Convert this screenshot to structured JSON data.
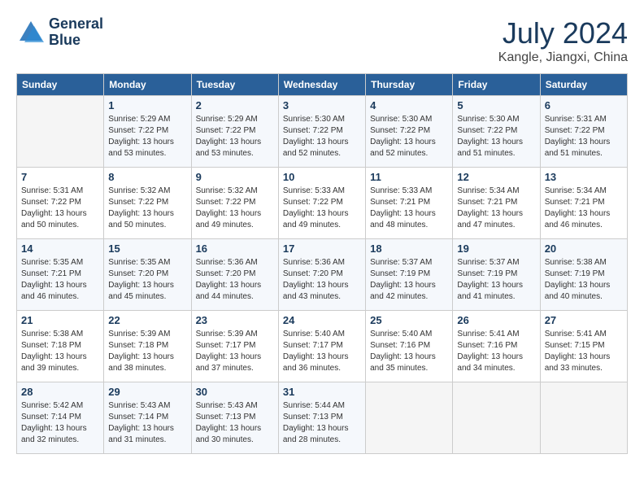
{
  "header": {
    "logo_line1": "General",
    "logo_line2": "Blue",
    "title": "July 2024",
    "location": "Kangle, Jiangxi, China"
  },
  "weekdays": [
    "Sunday",
    "Monday",
    "Tuesday",
    "Wednesday",
    "Thursday",
    "Friday",
    "Saturday"
  ],
  "weeks": [
    [
      {
        "day": "",
        "empty": true
      },
      {
        "day": "1",
        "sunrise": "5:29 AM",
        "sunset": "7:22 PM",
        "daylight": "13 hours and 53 minutes."
      },
      {
        "day": "2",
        "sunrise": "5:29 AM",
        "sunset": "7:22 PM",
        "daylight": "13 hours and 53 minutes."
      },
      {
        "day": "3",
        "sunrise": "5:30 AM",
        "sunset": "7:22 PM",
        "daylight": "13 hours and 52 minutes."
      },
      {
        "day": "4",
        "sunrise": "5:30 AM",
        "sunset": "7:22 PM",
        "daylight": "13 hours and 52 minutes."
      },
      {
        "day": "5",
        "sunrise": "5:30 AM",
        "sunset": "7:22 PM",
        "daylight": "13 hours and 51 minutes."
      },
      {
        "day": "6",
        "sunrise": "5:31 AM",
        "sunset": "7:22 PM",
        "daylight": "13 hours and 51 minutes."
      }
    ],
    [
      {
        "day": "7",
        "sunrise": "5:31 AM",
        "sunset": "7:22 PM",
        "daylight": "13 hours and 50 minutes."
      },
      {
        "day": "8",
        "sunrise": "5:32 AM",
        "sunset": "7:22 PM",
        "daylight": "13 hours and 50 minutes."
      },
      {
        "day": "9",
        "sunrise": "5:32 AM",
        "sunset": "7:22 PM",
        "daylight": "13 hours and 49 minutes."
      },
      {
        "day": "10",
        "sunrise": "5:33 AM",
        "sunset": "7:22 PM",
        "daylight": "13 hours and 49 minutes."
      },
      {
        "day": "11",
        "sunrise": "5:33 AM",
        "sunset": "7:21 PM",
        "daylight": "13 hours and 48 minutes."
      },
      {
        "day": "12",
        "sunrise": "5:34 AM",
        "sunset": "7:21 PM",
        "daylight": "13 hours and 47 minutes."
      },
      {
        "day": "13",
        "sunrise": "5:34 AM",
        "sunset": "7:21 PM",
        "daylight": "13 hours and 46 minutes."
      }
    ],
    [
      {
        "day": "14",
        "sunrise": "5:35 AM",
        "sunset": "7:21 PM",
        "daylight": "13 hours and 46 minutes."
      },
      {
        "day": "15",
        "sunrise": "5:35 AM",
        "sunset": "7:20 PM",
        "daylight": "13 hours and 45 minutes."
      },
      {
        "day": "16",
        "sunrise": "5:36 AM",
        "sunset": "7:20 PM",
        "daylight": "13 hours and 44 minutes."
      },
      {
        "day": "17",
        "sunrise": "5:36 AM",
        "sunset": "7:20 PM",
        "daylight": "13 hours and 43 minutes."
      },
      {
        "day": "18",
        "sunrise": "5:37 AM",
        "sunset": "7:19 PM",
        "daylight": "13 hours and 42 minutes."
      },
      {
        "day": "19",
        "sunrise": "5:37 AM",
        "sunset": "7:19 PM",
        "daylight": "13 hours and 41 minutes."
      },
      {
        "day": "20",
        "sunrise": "5:38 AM",
        "sunset": "7:19 PM",
        "daylight": "13 hours and 40 minutes."
      }
    ],
    [
      {
        "day": "21",
        "sunrise": "5:38 AM",
        "sunset": "7:18 PM",
        "daylight": "13 hours and 39 minutes."
      },
      {
        "day": "22",
        "sunrise": "5:39 AM",
        "sunset": "7:18 PM",
        "daylight": "13 hours and 38 minutes."
      },
      {
        "day": "23",
        "sunrise": "5:39 AM",
        "sunset": "7:17 PM",
        "daylight": "13 hours and 37 minutes."
      },
      {
        "day": "24",
        "sunrise": "5:40 AM",
        "sunset": "7:17 PM",
        "daylight": "13 hours and 36 minutes."
      },
      {
        "day": "25",
        "sunrise": "5:40 AM",
        "sunset": "7:16 PM",
        "daylight": "13 hours and 35 minutes."
      },
      {
        "day": "26",
        "sunrise": "5:41 AM",
        "sunset": "7:16 PM",
        "daylight": "13 hours and 34 minutes."
      },
      {
        "day": "27",
        "sunrise": "5:41 AM",
        "sunset": "7:15 PM",
        "daylight": "13 hours and 33 minutes."
      }
    ],
    [
      {
        "day": "28",
        "sunrise": "5:42 AM",
        "sunset": "7:14 PM",
        "daylight": "13 hours and 32 minutes."
      },
      {
        "day": "29",
        "sunrise": "5:43 AM",
        "sunset": "7:14 PM",
        "daylight": "13 hours and 31 minutes."
      },
      {
        "day": "30",
        "sunrise": "5:43 AM",
        "sunset": "7:13 PM",
        "daylight": "13 hours and 30 minutes."
      },
      {
        "day": "31",
        "sunrise": "5:44 AM",
        "sunset": "7:13 PM",
        "daylight": "13 hours and 28 minutes."
      },
      {
        "day": "",
        "empty": true
      },
      {
        "day": "",
        "empty": true
      },
      {
        "day": "",
        "empty": true
      }
    ]
  ],
  "labels": {
    "sunrise": "Sunrise:",
    "sunset": "Sunset:",
    "daylight": "Daylight:"
  }
}
